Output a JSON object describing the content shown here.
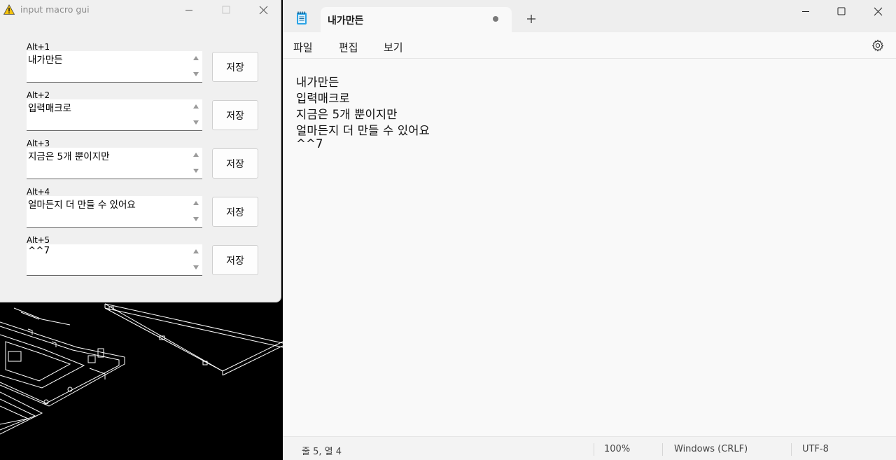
{
  "macro_window": {
    "title": "input macro gui",
    "rows": [
      {
        "label": "Alt+1",
        "text": "내가만든",
        "button": "저장"
      },
      {
        "label": "Alt+2",
        "text": "입력매크로",
        "button": "저장"
      },
      {
        "label": "Alt+3",
        "text": "지금은 5개 뿐이지만",
        "button": "저장"
      },
      {
        "label": "Alt+4",
        "text": "얼마든지 더 만들 수 있어요",
        "button": "저장"
      },
      {
        "label": "Alt+5",
        "text": "^^7",
        "button": "저장"
      }
    ]
  },
  "notepad": {
    "tab_title": "내가만든",
    "menu": {
      "file": "파일",
      "edit": "편집",
      "view": "보기"
    },
    "lines": [
      "내가만든",
      "입력매크로",
      "지금은 5개 뿐이지만",
      "얼마든지 더 만들 수 있어요",
      "^^7"
    ],
    "status": {
      "position": "줄 5, 열 4",
      "zoom": "100%",
      "line_ending": "Windows (CRLF)",
      "encoding": "UTF-8"
    }
  },
  "icons": {
    "macro_app": "warning-icon",
    "notepad_app": "notepad-icon",
    "settings": "gear-icon"
  },
  "colors": {
    "notepad_bg": "#f9f9f9",
    "tabbar_bg": "#eeeeee",
    "macro_bg": "#f0f0f0",
    "warning_yellow": "#f4c20d"
  }
}
